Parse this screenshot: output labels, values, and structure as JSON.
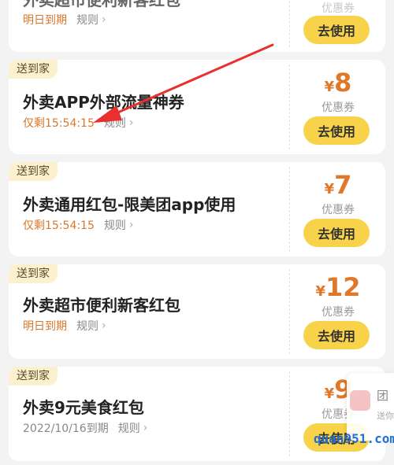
{
  "coupons": [
    {
      "tag": "",
      "title": "外卖超市便利新客红包",
      "expire": "明日到期",
      "rule": "规则",
      "currency": "",
      "amount": "",
      "ticket_label": "优惠券",
      "button": "去使用"
    },
    {
      "tag": "送到家",
      "title": "外卖APP外部流量神券",
      "expire": "仅剩15:54:15",
      "rule": "规则",
      "currency": "¥",
      "amount": "8",
      "ticket_label": "优惠券",
      "button": "去使用"
    },
    {
      "tag": "送到家",
      "title": "外卖通用红包-限美团app使用",
      "expire": "仅剩15:54:15",
      "rule": "规则",
      "currency": "¥",
      "amount": "7",
      "ticket_label": "优惠券",
      "button": "去使用"
    },
    {
      "tag": "送到家",
      "title": "外卖超市便利新客红包",
      "expire": "明日到期",
      "rule": "规则",
      "currency": "¥",
      "amount": "12",
      "ticket_label": "优惠券",
      "button": "去使用"
    },
    {
      "tag": "送到家",
      "title": "外卖9元美食红包",
      "expire": "2022/10/16到期",
      "rule": "规则",
      "currency": "¥",
      "amount": "9",
      "ticket_label": "优惠券",
      "button": "去使用"
    }
  ],
  "side_float": {
    "text1": "团",
    "text2": "送你"
  },
  "watermark": "quan951.com",
  "colors": {
    "accent_orange": "#e0782a",
    "button_yellow": "#f8d34a",
    "tag_bg": "#fcf1cf",
    "annotation_arrow": "#e8312f"
  },
  "icons": [
    "chevron-right-icon",
    "red-annotation-arrow-icon"
  ]
}
